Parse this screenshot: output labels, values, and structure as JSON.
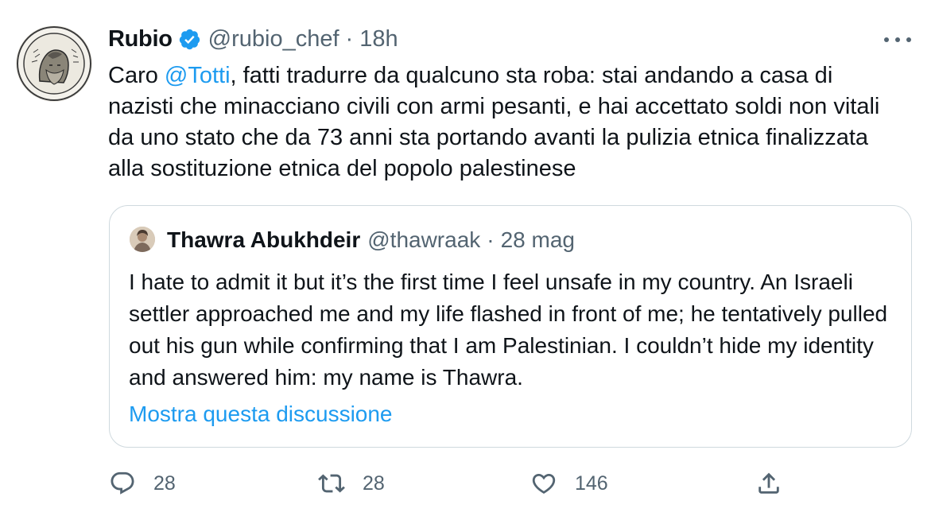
{
  "tweet": {
    "author": {
      "name": "Rubio",
      "handle": "@rubio_chef",
      "separator": "·",
      "time": "18h",
      "verified": true,
      "avatar_icon": "engraved-portrait-medallion"
    },
    "text": {
      "part1": "Caro ",
      "mention": "@Totti",
      "part2": ", fatti tradurre da qualcuno sta roba: stai andando a casa di nazisti che minacciano civili con armi pesanti, e hai accettato soldi non vitali da uno stato che da 73 anni sta portando avanti la pulizia etnica finalizzata alla sostituzione etnica del popolo palestinese"
    },
    "quoted": {
      "name": "Thawra Abukhdeir",
      "handle": "@thawraak",
      "separator": "·",
      "time": "28 mag",
      "text": "I hate to admit it but it’s the first time I feel unsafe in my country. An Israeli settler approached me and my life flashed in front of me; he tentatively pulled out his gun while confirming that I am Palestinian. I couldn’t hide my identity and answered him: my name is Thawra.",
      "show_thread": "Mostra questa discussione"
    },
    "actions": {
      "replies": "28",
      "retweets": "28",
      "likes": "146"
    }
  },
  "icons": {
    "more": "more-horizontal-icon",
    "verified": "verified-badge-icon",
    "reply": "reply-icon",
    "retweet": "retweet-icon",
    "like": "heart-icon",
    "share": "share-icon"
  },
  "colors": {
    "text": "#0f1419",
    "secondary": "#536471",
    "accent": "#1d9bf0",
    "border": "#cfd9de"
  }
}
